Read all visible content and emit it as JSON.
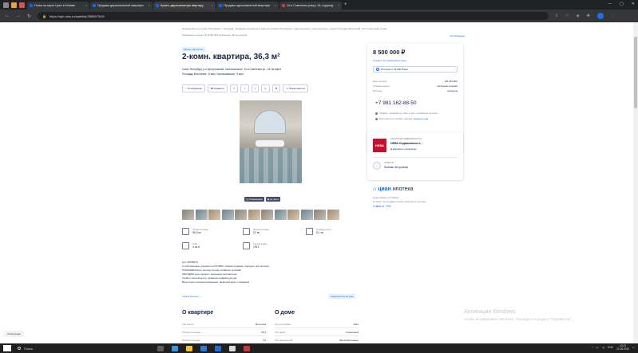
{
  "browser": {
    "tabs": [
      {
        "label": "Поиск на карте Циан в Москве",
        "active": false
      },
      {
        "label": "Продажа двухкомнатной квартиры",
        "active": false
      },
      {
        "label": "Купить двухкомнатную квартиру",
        "active": true
      },
      {
        "label": "Продажа однокомнатной квартиры",
        "active": false
      },
      {
        "label": "10-я Советская улица, 18, подъезд",
        "active": false
      }
    ],
    "new_tab": "+",
    "url": "https://spb.cian.ru/sale/flat/285557943/"
  },
  "breadcrumb": "Недвижимость в Санкт-Петербурге › Продажа › Продажа 2-комнатных квартир в Санкт-Петербурге › Центральный › Смольнинское › метро Площадь Восстания › 10-я Советская улица",
  "updated": "Обновлено: вчера, 13:48   👁 384 просмотра, 38 за сегодня",
  "favorite_link": "В избранное",
  "badge_new": "Можно увеличить",
  "title": "2-комн. квартира, 36,3 м²",
  "address": "Санкт-Петербург, р-н Центральный, Смольнинское, 10-я Советская ул., 18   На карте",
  "metro": "Площадь Восстания · 8 мин.   Чернышевская · 9 мин.",
  "actions": [
    "♡ В избранное",
    "⇆ Сравнить",
    "⇪",
    "✓",
    "⤓",
    "⎙",
    "⚑",
    "⚠ Пожаловаться"
  ],
  "photo_buttons": [
    "Планировка",
    "12 фото"
  ],
  "thumb_count": 12,
  "specs": [
    {
      "label": "Общая площадь",
      "value": "36,3 м²"
    },
    {
      "label": "Жилая площадь",
      "value": "22 м²"
    },
    {
      "label": "Площадь кухни",
      "value": "6,1 м²"
    },
    {
      "label": "Этаж",
      "value": "4 из 6"
    },
    {
      "label": "Год постройки",
      "value": "1912"
    }
  ],
  "description": [
    "Арт. 45788979",
    "2 собственника, документы ГОТОВЫ, прямая продажа, подходит для ипотеки.",
    "ПОМОЖЕМ взять ипотеку исходя из Ваших условий!",
    "ОБСУДИМ цену сделки с реальным покупателем.",
    "Тихий и чистый центр, развитая инфраструктура.",
    "Вход через отремонтированный, закрытый двор с парадной."
  ],
  "show_more": "Узнать больше ⌄",
  "apartment": {
    "title": "О квартире",
    "rows": [
      {
        "k": "Тип жилья",
        "v": "Вторичка"
      },
      {
        "k": "Общая площадь",
        "v": "36,3"
      },
      {
        "k": "Жилая площадь",
        "v": "22"
      },
      {
        "k": "Площадь кухни",
        "v": "6,1"
      }
    ]
  },
  "house": {
    "title": "О доме",
    "ref_button": "Подписаться на дом",
    "rows": [
      {
        "k": "Год постройки",
        "v": "1912"
      },
      {
        "k": "Тип дома",
        "v": "Кирпичный"
      },
      {
        "k": "Тип перекрытий",
        "v": "Железобетонные"
      },
      {
        "k": "Подъезды",
        "v": "4"
      }
    ]
  },
  "sidebar": {
    "price": "8 500 000 ₽",
    "price_track": "Следить за изменением цены",
    "mortgage": "Ипотека от 54 000 ₽/мес",
    "details": [
      {
        "k": "Цена за метр",
        "v": "234 160 ₽/м²"
      },
      {
        "k": "Условия сделки",
        "v": "свободная продажа"
      },
      {
        "k": "Ипотека",
        "v": "возможна"
      }
    ],
    "phone": "+7 981 162-88-50",
    "notes": [
      {
        "text": "Читайте, пожалуйста, ответ в чате, сообщение на доске",
        "link": ""
      },
      {
        "text": "Если захотите оставить жалобу,",
        "link": "напишите нам"
      }
    ],
    "agency": {
      "logo": "НЕВА",
      "tag": "АГЕНТСТВО НЕДВИЖИМОСТИ",
      "name": "НЕВА Недвижимость",
      "docs": "Документы проверены"
    },
    "agent": {
      "role": "РИЭЛТОР",
      "name": "Любовь Антропова"
    },
    "cian": {
      "logo_brand": "циан",
      "logo_text": "ипотека",
      "lines": [
        "Одна заявка в 12 банков",
        "15 минут на предварительное решение по ипотеке"
      ],
      "rate": "Ставка от 7,9%"
    }
  },
  "windows_watermark": {
    "line1": "Активация Windows",
    "line2": "Чтобы активировать Windows, перейдите в раздел \"Параметры\"."
  },
  "status_pill": "Точка входа",
  "taskbar": {
    "search": "Поиск",
    "tray": "ENG",
    "time": "13:23",
    "date": "22.08.2023"
  },
  "colors": {
    "accent": "#0468ff",
    "text": "#152242",
    "muted": "#737a8e",
    "agency": "#c8102e"
  }
}
